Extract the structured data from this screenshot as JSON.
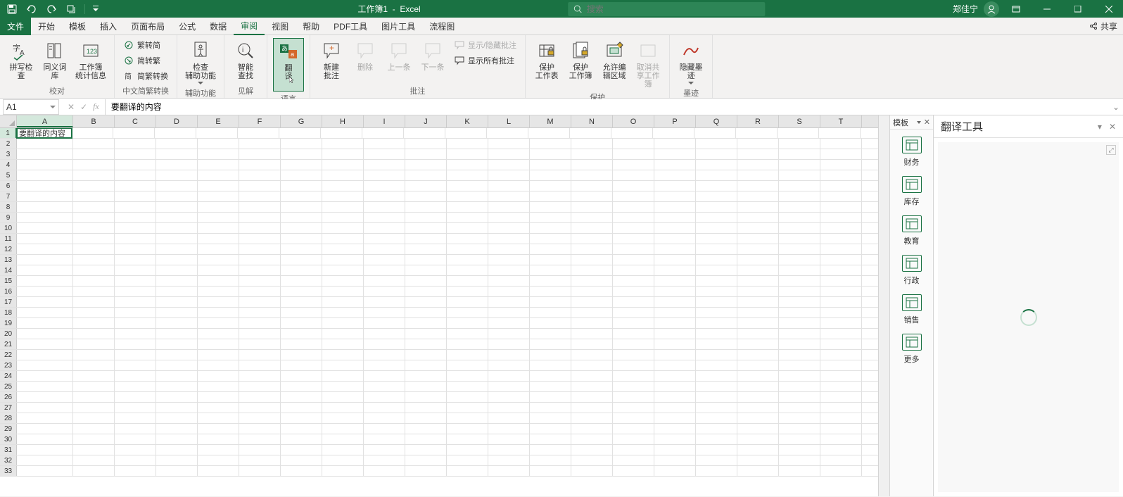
{
  "title": {
    "doc": "工作簿1",
    "app": "Excel"
  },
  "search": {
    "placeholder": "搜索"
  },
  "user": {
    "name": "郑佳宁"
  },
  "tabs": {
    "file": "文件",
    "items": [
      "开始",
      "模板",
      "插入",
      "页面布局",
      "公式",
      "数据",
      "审阅",
      "视图",
      "帮助",
      "PDF工具",
      "图片工具",
      "流程图"
    ],
    "active_index": 6,
    "share": "共享"
  },
  "ribbon": {
    "proofing": {
      "label": "校对",
      "spell": "拼写检查",
      "thesaurus": "同义词库",
      "stats": "工作簿\n统计信息"
    },
    "chinese": {
      "label": "中文简繁转换",
      "t2s": "繁转简",
      "s2t": "简转繁",
      "conv": "简繁转换"
    },
    "a11y": {
      "label": "辅助功能",
      "check": "检查\n辅助功能"
    },
    "insights": {
      "label": "见解",
      "smart": "智能\n查找"
    },
    "language": {
      "label": "语言",
      "translate": "翻\n译"
    },
    "comments": {
      "label": "批注",
      "new": "新建\n批注",
      "delete": "删除",
      "prev": "上一条",
      "next": "下一条",
      "showhide": "显示/隐藏批注",
      "showall": "显示所有批注"
    },
    "protect": {
      "label": "保护",
      "sheet": "保护\n工作表",
      "book": "保护\n工作簿",
      "allow": "允许编\n辑区域",
      "unshare": "取消共\n享工作簿"
    },
    "ink": {
      "label": "墨迹",
      "hide": "隐藏墨\n迹"
    }
  },
  "formula_bar": {
    "name_box": "A1",
    "value": "要翻译的内容"
  },
  "grid": {
    "columns": [
      "A",
      "B",
      "C",
      "D",
      "E",
      "F",
      "G",
      "H",
      "I",
      "J",
      "K",
      "L",
      "M",
      "N",
      "O",
      "P",
      "Q",
      "R",
      "S",
      "T"
    ],
    "row_count": 33,
    "active_cell_value": "要翻译的内容"
  },
  "template_sidebar": {
    "title": "模板",
    "items": [
      {
        "label": "财务"
      },
      {
        "label": "库存"
      },
      {
        "label": "教育"
      },
      {
        "label": "行政"
      },
      {
        "label": "销售"
      },
      {
        "label": "更多"
      }
    ]
  },
  "translate_panel": {
    "title": "翻译工具"
  }
}
